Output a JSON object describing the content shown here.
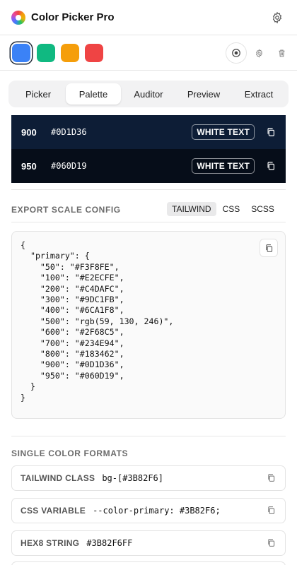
{
  "app": {
    "title": "Color Picker Pro"
  },
  "header": {
    "settings_icon": "gear-icon"
  },
  "swatches": [
    {
      "color": "#3B82F6",
      "selected": true
    },
    {
      "color": "#10B981",
      "selected": false
    },
    {
      "color": "#F59E0B",
      "selected": false
    },
    {
      "color": "#EF4444",
      "selected": false
    }
  ],
  "toolbar": {
    "icons": [
      "eyedropper-target-icon",
      "gear-icon",
      "trash-icon"
    ]
  },
  "tabs": [
    {
      "label": "Picker",
      "active": false
    },
    {
      "label": "Palette",
      "active": true
    },
    {
      "label": "Auditor",
      "active": false
    },
    {
      "label": "Preview",
      "active": false
    },
    {
      "label": "Extract",
      "active": false
    }
  ],
  "scale_rows": [
    {
      "step": "900",
      "hex": "#0D1D36",
      "badge": "WHITE TEXT",
      "color": "#0D1D36"
    },
    {
      "step": "950",
      "hex": "#060D19",
      "badge": "WHITE TEXT",
      "color": "#060D19"
    }
  ],
  "export": {
    "title": "EXPORT SCALE CONFIG",
    "formats": [
      "TAILWIND",
      "CSS",
      "SCSS"
    ],
    "active_format": "TAILWIND",
    "code": "{\n  \"primary\": {\n    \"50\": \"#F3F8FE\",\n    \"100\": \"#E2ECFE\",\n    \"200\": \"#C4DAFC\",\n    \"300\": \"#9DC1FB\",\n    \"400\": \"#6CA1F8\",\n    \"500\": \"rgb(59, 130, 246)\",\n    \"600\": \"#2F68C5\",\n    \"700\": \"#234E94\",\n    \"800\": \"#183462\",\n    \"900\": \"#0D1D36\",\n    \"950\": \"#060D19\",\n  }\n}"
  },
  "single_formats": {
    "title": "SINGLE COLOR FORMATS",
    "rows": [
      {
        "label": "TAILWIND CLASS",
        "value": "bg-[#3B82F6]"
      },
      {
        "label": "CSS VARIABLE",
        "value": "--color-primary: #3B82F6;"
      },
      {
        "label": "HEX8 STRING",
        "value": "#3B82F6FF"
      }
    ]
  }
}
